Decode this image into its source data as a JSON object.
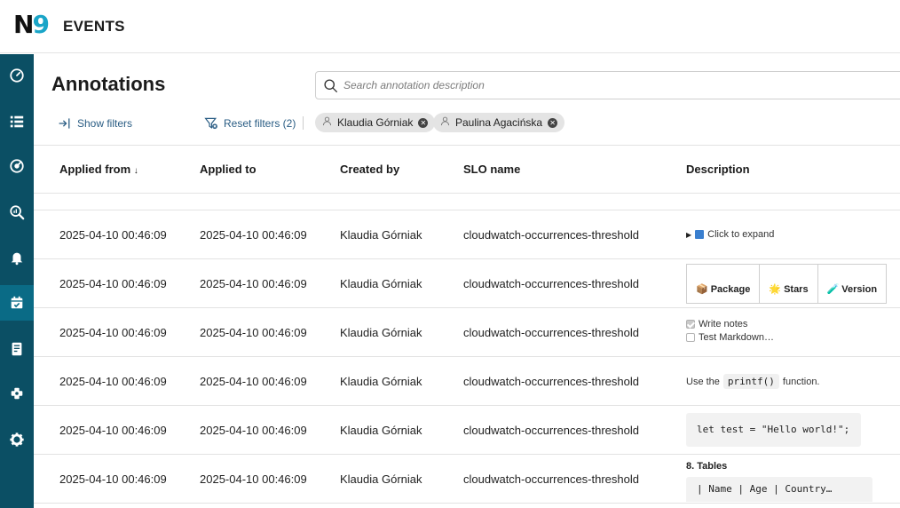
{
  "app": {
    "logo_n": "N",
    "logo_9": "9",
    "title": "EVENTS"
  },
  "sidebar": {
    "items": [
      {
        "icon": "gauge-icon"
      },
      {
        "icon": "list-icon"
      },
      {
        "icon": "target-icon"
      },
      {
        "icon": "search-analytics-icon"
      },
      {
        "icon": "bell-icon"
      },
      {
        "icon": "calendar-icon",
        "active": true
      },
      {
        "icon": "report-icon"
      },
      {
        "icon": "integrations-icon"
      },
      {
        "icon": "gear-icon"
      }
    ]
  },
  "page": {
    "title": "Annotations"
  },
  "search": {
    "placeholder": "Search annotation description",
    "value": ""
  },
  "filters": {
    "show_label": "Show filters",
    "reset_label": "Reset filters (2)",
    "chips": [
      {
        "label": "Klaudia Górniak"
      },
      {
        "label": "Paulina Agacińska"
      }
    ]
  },
  "table": {
    "columns": {
      "applied_from": "Applied from",
      "sort_indicator": "↓",
      "applied_to": "Applied to",
      "created_by": "Created by",
      "slo_name": "SLO name",
      "description": "Description"
    },
    "rows": [
      {
        "from": "2025-04-10 00:46:09",
        "to": "2025-04-10 00:46:09",
        "by": "Klaudia Górniak",
        "slo": "cloudwatch-occurrences-threshold"
      },
      {
        "from": "2025-04-10 00:46:09",
        "to": "2025-04-10 00:46:09",
        "by": "Klaudia Górniak",
        "slo": "cloudwatch-occurrences-threshold"
      },
      {
        "from": "2025-04-10 00:46:09",
        "to": "2025-04-10 00:46:09",
        "by": "Klaudia Górniak",
        "slo": "cloudwatch-occurrences-threshold"
      },
      {
        "from": "2025-04-10 00:46:09",
        "to": "2025-04-10 00:46:09",
        "by": "Klaudia Górniak",
        "slo": "cloudwatch-occurrences-threshold"
      },
      {
        "from": "2025-04-10 00:46:09",
        "to": "2025-04-10 00:46:09",
        "by": "Klaudia Górniak",
        "slo": "cloudwatch-occurrences-threshold"
      },
      {
        "from": "2025-04-10 00:46:09",
        "to": "2025-04-10 00:46:09",
        "by": "Klaudia Górniak",
        "slo": "cloudwatch-occurrences-threshold"
      }
    ],
    "descriptions": {
      "expand": {
        "triangle": "▶",
        "label": "Click to expand"
      },
      "tabs": [
        {
          "glyph": "📦",
          "label": "Package"
        },
        {
          "glyph": "🌟",
          "label": "Stars"
        },
        {
          "glyph": "🧪",
          "label": "Version"
        }
      ],
      "checklist": [
        {
          "label": "Write notes",
          "checked": true
        },
        {
          "label": "Test Markdown…",
          "checked": false
        }
      ],
      "inline": {
        "before": "Use the",
        "code": "printf()",
        "after": "function."
      },
      "code_block": "let test = \"Hello world!\";",
      "tables": {
        "heading": "8. Tables",
        "line": "| Name     | Age | Country…"
      }
    }
  }
}
